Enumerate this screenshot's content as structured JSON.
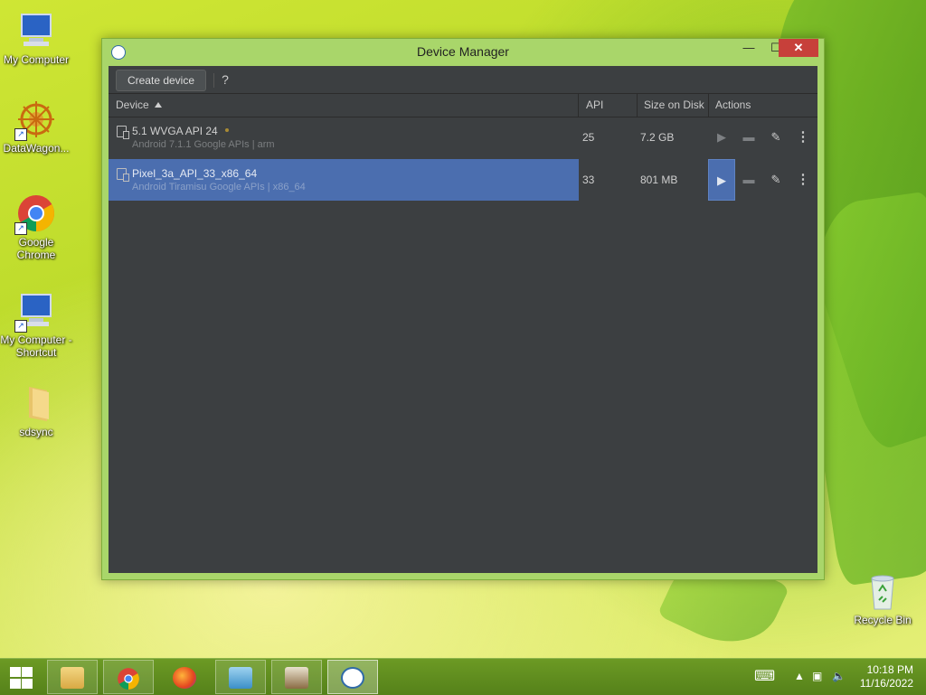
{
  "desktop": {
    "icons": [
      {
        "label": "My Computer"
      },
      {
        "label": "DataWagon..."
      },
      {
        "label": "Google Chrome"
      },
      {
        "label": "My Computer - Shortcut"
      },
      {
        "label": "sdsync"
      }
    ],
    "recycle_bin": {
      "label": "Recycle Bin"
    }
  },
  "window": {
    "title": "Device Manager",
    "controls": {
      "minimize": "—",
      "maximize": "☐",
      "close": "✕"
    }
  },
  "toolbar": {
    "create_label": "Create device",
    "help_label": "?"
  },
  "table": {
    "columns": {
      "device": "Device",
      "api": "API",
      "size": "Size on Disk",
      "actions": "Actions"
    },
    "rows": [
      {
        "name": "5.1  WVGA API 24",
        "sub": "Android 7.1.1 Google APIs | arm",
        "api": "25",
        "size": "7.2 GB",
        "selected": false
      },
      {
        "name": "Pixel_3a_API_33_x86_64",
        "sub": "Android Tiramisu Google APIs | x86_64",
        "api": "33",
        "size": "801 MB",
        "selected": true
      }
    ]
  },
  "icons": {
    "run": "▶",
    "folder": "▬",
    "edit": "✎",
    "more": "⋮"
  },
  "taskbar": {
    "clock_time": "10:18 PM",
    "clock_date": "11/16/2022",
    "apps": [
      "file-explorer",
      "google-chrome",
      "firefox",
      "control-panel",
      "app-installer",
      "android-studio"
    ]
  },
  "colors": {
    "selection": "#4b6eaf",
    "panel": "#3c3f41",
    "close": "#c7403a",
    "taskbar": "#5f8c1f"
  }
}
